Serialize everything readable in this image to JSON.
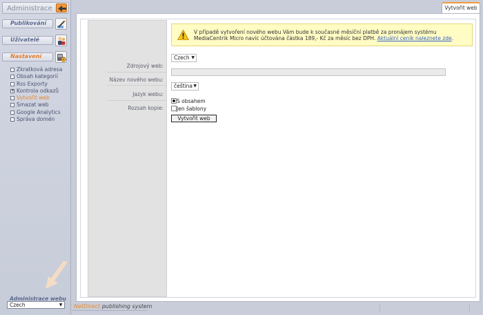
{
  "sidebar": {
    "title": "Administrace",
    "sections": [
      {
        "label": "Publikování",
        "icon": "pencil-icon"
      },
      {
        "label": "Uživatelé",
        "icon": "users-icon"
      },
      {
        "label": "Nastavení",
        "icon": "settings-icon"
      }
    ],
    "menu": [
      {
        "label": "Zkratková adresa"
      },
      {
        "label": "Obsah kategorií"
      },
      {
        "label": "Rss Exporty"
      },
      {
        "label": "Kontrola odkazů"
      },
      {
        "label": "Vytvořit web"
      },
      {
        "label": "Smazat web"
      },
      {
        "label": "Google Analytics"
      },
      {
        "label": "Správa domén"
      }
    ],
    "admin_web_label": "Administrace webu",
    "admin_web_value": "Czech"
  },
  "tab": {
    "label": "Vytvořit web"
  },
  "warning": {
    "text": "V případě vytvoření nového webu Vám bude k současné měsíční platbě za pronájem systému MediaCentrik Micro navíc účtována částka 189,- Kč za měsíc bez DPH.",
    "link": "Aktuální ceník naleznete zde"
  },
  "form": {
    "source_label": "Zdrojový web:",
    "source_value": "Czech",
    "name_label": "Název nového webu:",
    "lang_label": "Jazyk webu:",
    "lang_value": "čeština",
    "copy_label": "Rozsah kopie:",
    "option_with_content": "S obsahem",
    "option_templates_only": "Jen šablony",
    "submit_label": "Vytvořit web"
  },
  "footer": {
    "brand_prefix": "NetDirect",
    "brand_suffix": "publishing system"
  },
  "colors": {
    "accent": "#f09a3e",
    "link": "#3a62c7",
    "warning_bg": "#fffcc4"
  }
}
